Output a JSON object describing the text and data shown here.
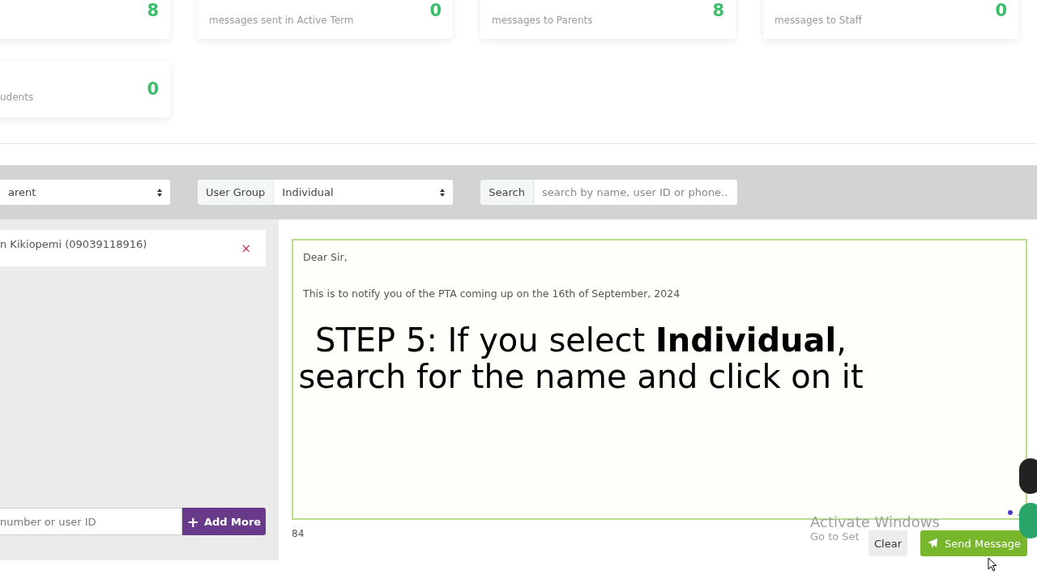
{
  "stats": [
    {
      "value": "8"
    },
    {
      "label": "messages sent in Active Term",
      "value": "0"
    },
    {
      "label": "messages to Parents",
      "value": "8"
    },
    {
      "label": "messages to Staff",
      "value": "0"
    }
  ],
  "stats_row_2": [
    {
      "label": "udents",
      "value": "0"
    }
  ],
  "filters": {
    "recipient_select": "arent",
    "user_group": {
      "label": "User Group",
      "value": "Individual"
    },
    "search": {
      "label": "Search",
      "placeholder": "search by name, user ID or phone..."
    }
  },
  "recipients": [
    {
      "name": "n Kikiopemi (09039118916)",
      "remove": "×"
    }
  ],
  "add_field": {
    "placeholder": "number or user ID"
  },
  "add_button": {
    "icon": "+",
    "label": "Add More"
  },
  "message": {
    "value": "Dear Sir,\n\nThis is to notify you of the PTA coming up on the 16th of September, 2024"
  },
  "char_count": "84",
  "windows_notice": {
    "title": "Activate Windows",
    "subtitle": "Go to Set"
  },
  "buttons": [
    {
      "kind": "clear",
      "label": "Clear"
    },
    {
      "kind": "send",
      "label": "Send Message"
    }
  ],
  "caption": [
    "STEP 5: If you select **Individual**,",
    "search for the name and click on it"
  ]
}
